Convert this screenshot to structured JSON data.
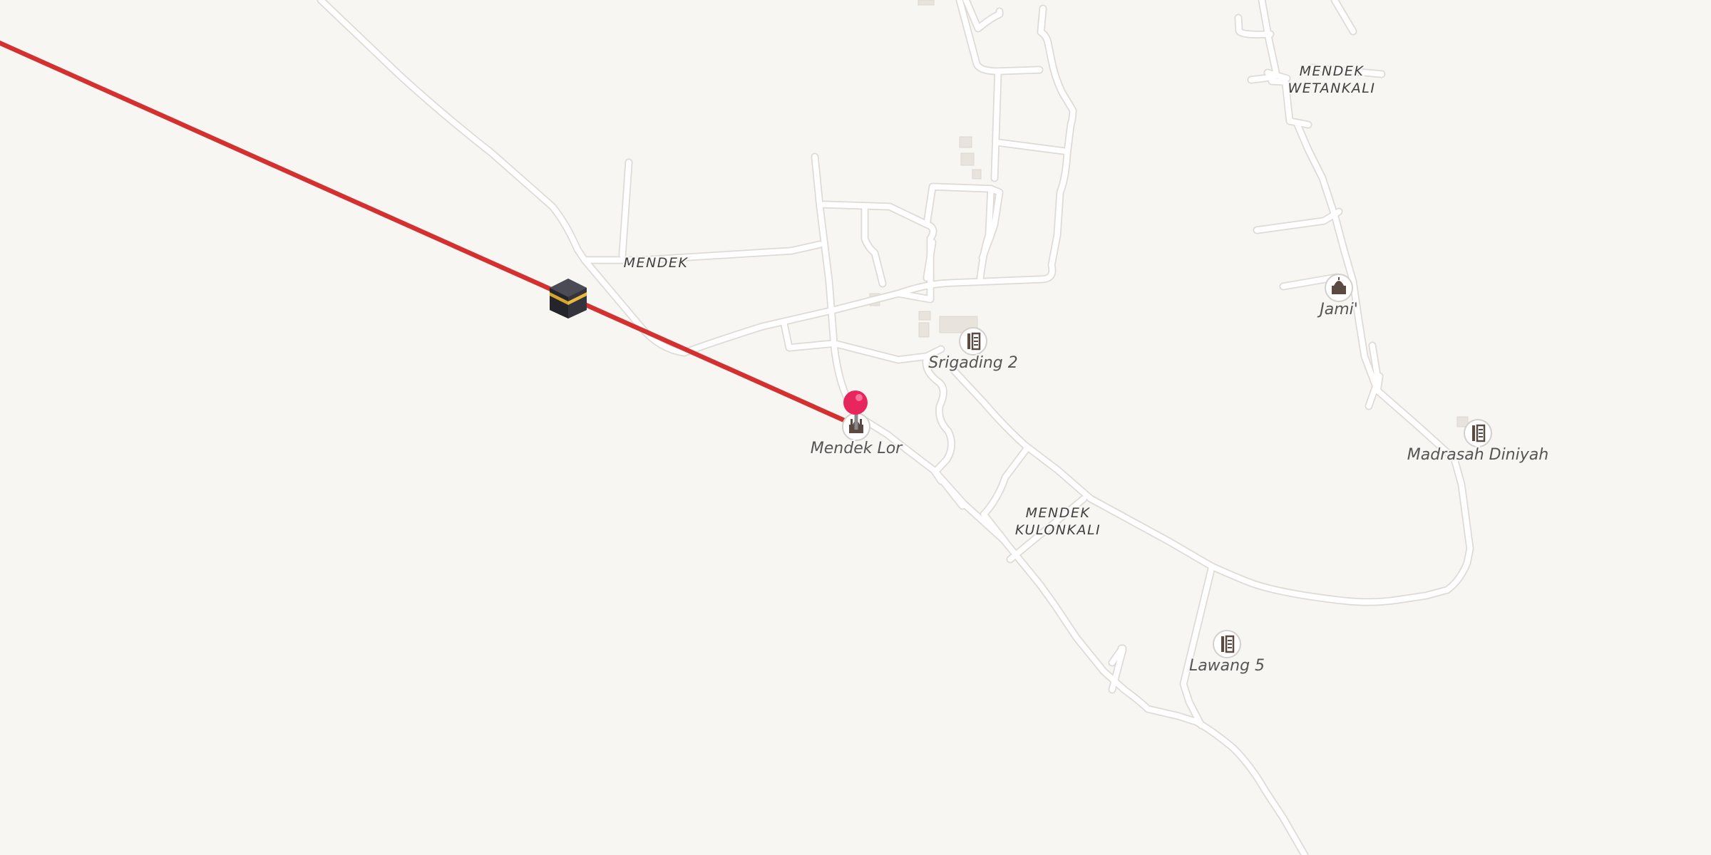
{
  "map": {
    "place_labels": {
      "mendek": "MENDEK",
      "mendek_wetankali_line1": "MENDEK",
      "mendek_wetankali_line2": "WETANKALI",
      "mendek_kulonkali_line1": "MENDEK",
      "mendek_kulonkali_line2": "KULONKALI"
    },
    "pois": {
      "srigading": {
        "label": "Srigading 2",
        "icon": "school-icon"
      },
      "mendek_lor": {
        "label": "Mendek Lor",
        "icon": "mosque-icon"
      },
      "jami": {
        "label": "Jami'",
        "icon": "mosque-icon"
      },
      "madrasah": {
        "label": "Madrasah Diniyah",
        "icon": "school-icon"
      },
      "lawang": {
        "label": "Lawang 5",
        "icon": "school-icon"
      }
    },
    "markers": {
      "location_pin": {
        "icon": "map-pin-icon",
        "color": "#e8265e"
      },
      "kaaba": {
        "icon": "kaaba-icon"
      }
    },
    "qibla_line": {
      "color": "#d3302f"
    },
    "colors": {
      "background": "#f8f6f3",
      "road": "#ffffff",
      "road_casing": "#dedad5"
    }
  }
}
